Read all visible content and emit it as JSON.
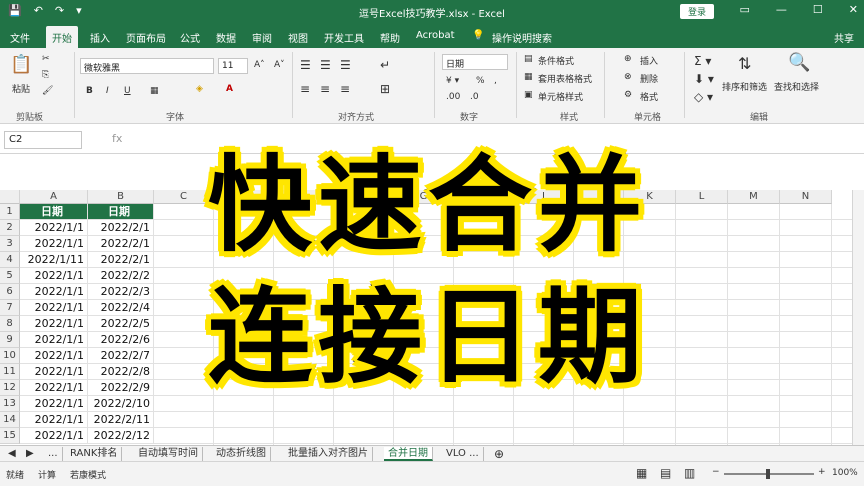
{
  "window": {
    "title": "逗号Excel技巧教学.xlsx - Excel",
    "login_label": "登录",
    "controls": [
      "▭",
      "—",
      "☐",
      "✕"
    ]
  },
  "quick_access": [
    "💾",
    "↶",
    "↷",
    "▾"
  ],
  "tabs": [
    "文件",
    "开始",
    "插入",
    "页面布局",
    "公式",
    "数据",
    "审阅",
    "视图",
    "开发工具",
    "帮助",
    "Acrobat",
    "操作说明搜索"
  ],
  "active_tab": "开始",
  "share_label": "共享",
  "ribbon": {
    "clipboard": {
      "paste_label": "粘贴",
      "group_label": "剪贴板"
    },
    "font": {
      "family": "微软雅黑",
      "size": "11",
      "bold": "B",
      "italic": "I",
      "underline": "U",
      "group_label": "字体"
    },
    "alignment": {
      "group_label": "对齐方式"
    },
    "number": {
      "format": "日期",
      "group_label": "数字"
    },
    "styles": {
      "conditional": "条件格式",
      "table": "套用表格格式",
      "cell": "单元格样式",
      "group_label": "样式"
    },
    "cells": {
      "insert": "插入",
      "delete": "删除",
      "format": "格式",
      "group_label": "单元格"
    },
    "editing": {
      "sort": "排序和筛选",
      "find": "查找和选择",
      "group_label": "编辑"
    }
  },
  "formula_bar": {
    "name_box": "C2",
    "fx": "fx"
  },
  "columns": [
    "A",
    "B",
    "C",
    "D",
    "E",
    "F",
    "G",
    "H",
    "I",
    "J",
    "K",
    "L",
    "M",
    "N"
  ],
  "rows": [
    {
      "num": "1",
      "a": "日期",
      "b": "日期"
    },
    {
      "num": "2",
      "a": "2022/1/1",
      "b": "2022/2/1"
    },
    {
      "num": "3",
      "a": "2022/1/1",
      "b": "2022/2/1"
    },
    {
      "num": "4",
      "a": "2022/1/11",
      "b": "2022/2/1"
    },
    {
      "num": "5",
      "a": "2022/1/1",
      "b": "2022/2/2"
    },
    {
      "num": "6",
      "a": "2022/1/1",
      "b": "2022/2/3"
    },
    {
      "num": "7",
      "a": "2022/1/1",
      "b": "2022/2/4"
    },
    {
      "num": "8",
      "a": "2022/1/1",
      "b": "2022/2/5"
    },
    {
      "num": "9",
      "a": "2022/1/1",
      "b": "2022/2/6"
    },
    {
      "num": "10",
      "a": "2022/1/1",
      "b": "2022/2/7"
    },
    {
      "num": "11",
      "a": "2022/1/1",
      "b": "2022/2/8"
    },
    {
      "num": "12",
      "a": "2022/1/1",
      "b": "2022/2/9"
    },
    {
      "num": "13",
      "a": "2022/1/1",
      "b": "2022/2/10"
    },
    {
      "num": "14",
      "a": "2022/1/1",
      "b": "2022/2/11"
    },
    {
      "num": "15",
      "a": "2022/1/1",
      "b": "2022/2/12"
    }
  ],
  "sheet_tabs": [
    "...",
    "RANK排名",
    "自动填写时间",
    "动态折线图",
    "批量插入对齐图片",
    "合并日期",
    "VLO ..."
  ],
  "active_sheet": "合并日期",
  "status": {
    "ready": "就绪",
    "calc": "计算",
    "mode": "若康模式",
    "zoom": "100%"
  },
  "overlay": {
    "line1": "快速合并",
    "line2": "连接日期",
    "stroke_color": "#ffe600"
  }
}
